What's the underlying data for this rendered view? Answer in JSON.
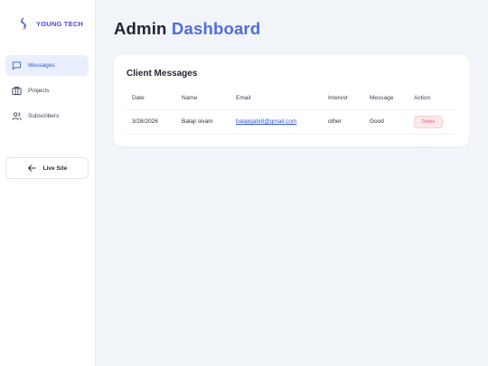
{
  "brand": {
    "name": "YOUNG TECH",
    "logo_icon": "leaf-logo-icon",
    "color": "#4f46e5"
  },
  "sidebar": {
    "items": [
      {
        "label": "Messages",
        "icon": "chat-icon",
        "active": true
      },
      {
        "label": "Projects",
        "icon": "briefcase-icon",
        "active": false
      },
      {
        "label": "Subscribers",
        "icon": "users-icon",
        "active": false
      }
    ],
    "live_site": {
      "label": "Live Site",
      "icon": "arrow-left-icon"
    }
  },
  "header": {
    "title_part1": "Admin",
    "title_part2": "Dashboard"
  },
  "messages": {
    "title": "Client Messages",
    "columns": [
      "Date",
      "Name",
      "Email",
      "Interest",
      "Message",
      "Action"
    ],
    "rows": [
      {
        "date": "3/28/2026",
        "name": "Balaji sivam",
        "email": "balajigabi8@gmail.com",
        "interest": "other",
        "message": "Good",
        "action": "Delete"
      }
    ]
  },
  "colors": {
    "accent": "#3159d6",
    "active_bg": "#e9effc",
    "delete_bg": "#fde8ea",
    "delete_text": "#e0606f",
    "page_bg": "#f1f4f9"
  }
}
